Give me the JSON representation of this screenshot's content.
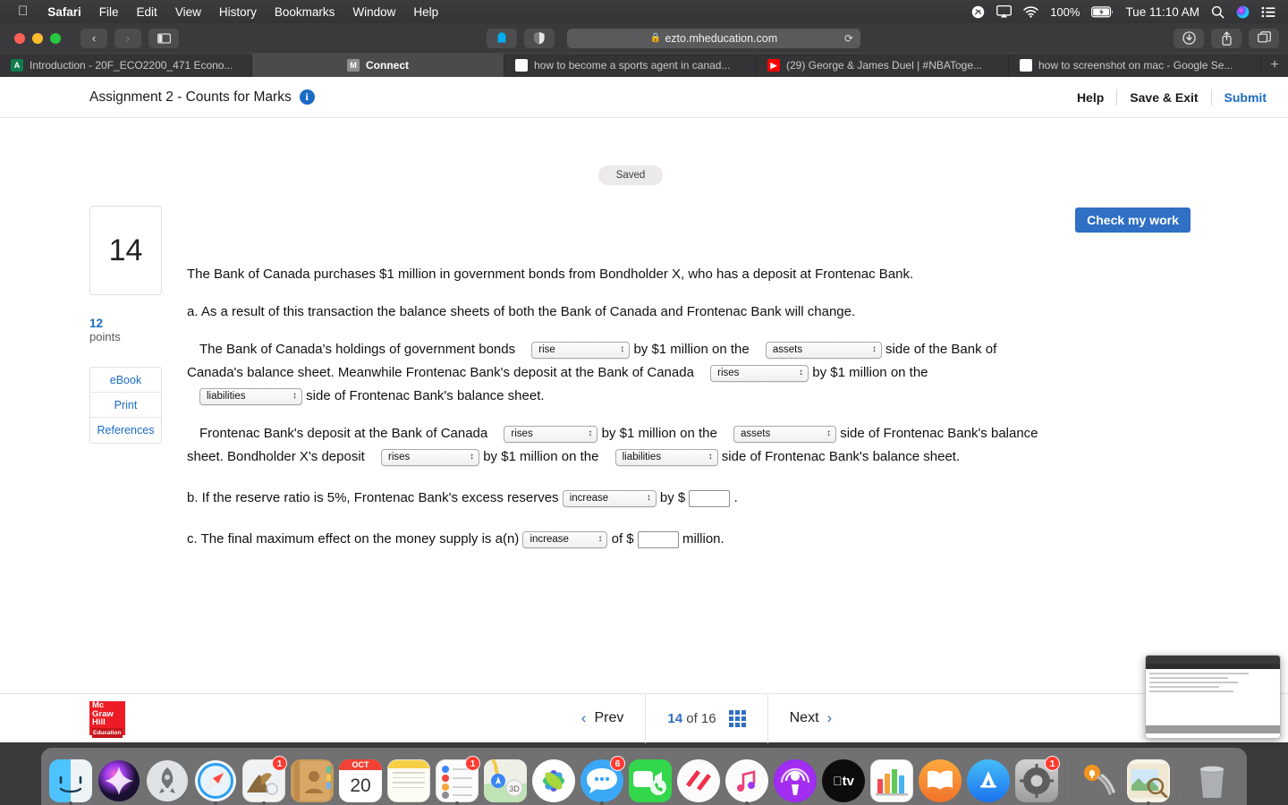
{
  "menubar": {
    "apple": "",
    "items": [
      "Safari",
      "File",
      "Edit",
      "View",
      "History",
      "Bookmarks",
      "Window",
      "Help"
    ],
    "battery_percent": "100%",
    "time": "Tue 11:10 AM"
  },
  "browser": {
    "url": "ezto.mheducation.com",
    "tabs": [
      {
        "title": "Introduction - 20F_ECO2200_471 Econo...",
        "favicon": "acrobat-icon",
        "active": false
      },
      {
        "title": "Connect",
        "favicon": "mcgrawhill-icon",
        "active": true
      },
      {
        "title": "how to become a sports agent in canad...",
        "favicon": "google-icon",
        "active": false
      },
      {
        "title": "(29) George & James Duel | #NBAToge...",
        "favicon": "youtube-icon",
        "active": false
      },
      {
        "title": "how to screenshot on mac - Google Se...",
        "favicon": "google-icon",
        "active": false
      }
    ]
  },
  "assignment": {
    "title": "Assignment 2 - Counts for Marks",
    "status_badge": "Saved",
    "help_label": "Help",
    "save_exit_label": "Save & Exit",
    "submit_label": "Submit",
    "check_work_label": "Check my work"
  },
  "rail": {
    "question_number": "14",
    "points_value": "12",
    "points_label": "points",
    "buttons": [
      "eBook",
      "Print",
      "References"
    ]
  },
  "question": {
    "intro": "The Bank of Canada purchases $1 million in government bonds from Bondholder X, who has a deposit at Frontenac Bank.",
    "part_a_lead": "a. As a result of this transaction the balance sheets of both the Bank of Canada and Frontenac Bank will change.",
    "p1_s1": "The Bank of Canada's holdings of government bonds",
    "p1_s2": "by $1 million on the",
    "p1_s3": "side of the Bank of Canada's balance sheet. Meanwhile Frontenac Bank's deposit at the Bank of Canada",
    "p1_s4": "by $1 million on the",
    "p1_s5": "side of Frontenac Bank's balance sheet.",
    "p2_s1": "Frontenac Bank's deposit at the Bank of Canada",
    "p2_s2": "by $1 million on the",
    "p2_s3": "side of Frontenac Bank's balance sheet. Bondholder X's deposit",
    "p2_s4": "by $1 million on the",
    "p2_s5": "side of Frontenac Bank's balance sheet.",
    "part_b_s1": "b. If the reserve ratio is 5%, Frontenac Bank's excess reserves",
    "part_b_s2": "by $",
    "part_b_s3": ".",
    "part_c_s1": "c. The final maximum effect on the money supply is a(n)",
    "part_c_s2": "of $",
    "part_c_s3": "million.",
    "dropdowns": {
      "d1": "rise",
      "d2": "assets",
      "d3": "rises",
      "d4": "liabilities",
      "d5": "rises",
      "d6": "assets",
      "d7": "rises",
      "d8": "liabilities",
      "d9": "increase",
      "d10": "increase"
    },
    "inputs": {
      "b_amount": "",
      "c_amount": ""
    }
  },
  "footer": {
    "logo_line1": "Mc",
    "logo_line2": "Graw",
    "logo_line3": "Hill",
    "logo_line4": "Education",
    "prev_label": "Prev",
    "next_label": "Next",
    "current_page": "14",
    "of_label": "of",
    "total_pages": "16"
  },
  "dock": {
    "items": [
      {
        "name": "finder",
        "badge": "",
        "running": true
      },
      {
        "name": "siri",
        "badge": "",
        "running": false
      },
      {
        "name": "launchpad",
        "badge": "",
        "running": false
      },
      {
        "name": "safari",
        "badge": "",
        "running": true
      },
      {
        "name": "mail",
        "badge": "1",
        "running": true
      },
      {
        "name": "contacts",
        "badge": "",
        "running": false
      },
      {
        "name": "calendar",
        "badge": "",
        "running": false
      },
      {
        "name": "notes",
        "badge": "",
        "running": false
      },
      {
        "name": "reminders",
        "badge": "1",
        "running": true
      },
      {
        "name": "maps",
        "badge": "",
        "running": false
      },
      {
        "name": "photos",
        "badge": "",
        "running": false
      },
      {
        "name": "messages",
        "badge": "6",
        "running": true
      },
      {
        "name": "facetime",
        "badge": "",
        "running": false
      },
      {
        "name": "news",
        "badge": "",
        "running": false
      },
      {
        "name": "music",
        "badge": "",
        "running": true
      },
      {
        "name": "podcasts",
        "badge": "",
        "running": false
      },
      {
        "name": "appletv",
        "badge": "",
        "running": false
      },
      {
        "name": "numbers",
        "badge": "",
        "running": false
      },
      {
        "name": "books",
        "badge": "",
        "running": false
      },
      {
        "name": "appstore",
        "badge": "",
        "running": false
      },
      {
        "name": "system-preferences",
        "badge": "1",
        "running": false
      },
      {
        "name": "keychain-access",
        "badge": "",
        "running": false
      },
      {
        "name": "preview",
        "badge": "",
        "running": true
      },
      {
        "name": "trash",
        "badge": "",
        "running": false
      }
    ],
    "calendar_month": "OCT",
    "calendar_day": "20",
    "appletv_label": "tv"
  },
  "colors": {
    "accent_blue": "#2f6fc4",
    "link_blue": "#1a6bc4",
    "mcgraw_red": "#ed1c24",
    "badge_red": "#ff3b30"
  }
}
